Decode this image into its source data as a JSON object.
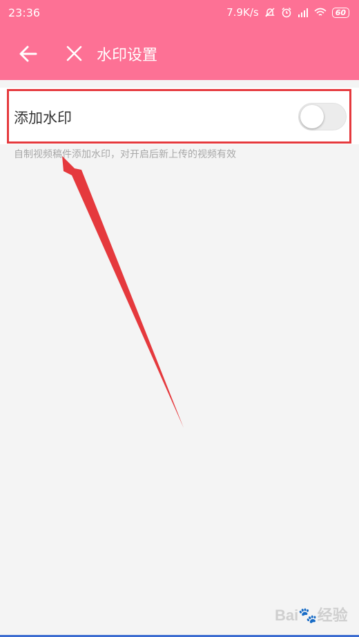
{
  "status_bar": {
    "time": "23:36",
    "net_speed": "7.9K/s",
    "battery": "60",
    "icons": [
      "mute-bell-icon",
      "alarm-icon",
      "signal-icon",
      "wifi-icon",
      "battery-icon"
    ]
  },
  "toolbar": {
    "title": "水印设置",
    "back_icon": "arrow-left-icon",
    "close_icon": "close-icon"
  },
  "setting": {
    "label": "添加水印",
    "toggle_on": false,
    "description": "自制视频稿件添加水印，对开启后新上传的视频有效"
  },
  "watermark": {
    "text": "Bai🐾经验"
  },
  "colors": {
    "accent": "#fd7195",
    "annotation": "#e5393d",
    "background": "#f4f4f4"
  }
}
